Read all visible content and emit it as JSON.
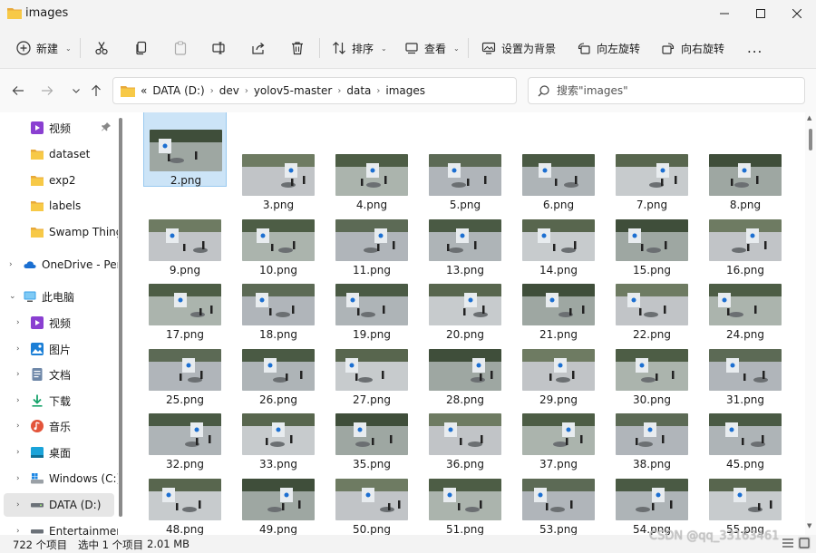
{
  "window": {
    "title": "images"
  },
  "toolbar": {
    "new": "新建",
    "sort": "排序",
    "view": "查看",
    "set_background": "设置为背景",
    "rotate_left": "向左旋转",
    "rotate_right": "向右旋转",
    "more": "..."
  },
  "address": {
    "overflow": "«",
    "crumbs": [
      "DATA (D:)",
      "dev",
      "yolov5-master",
      "data",
      "images"
    ]
  },
  "search": {
    "placeholder": "搜索\"images\""
  },
  "sidebar": {
    "items": [
      {
        "label": "视频",
        "icon": "video-icon"
      },
      {
        "label": "dataset",
        "icon": "folder-icon"
      },
      {
        "label": "exp2",
        "icon": "folder-icon"
      },
      {
        "label": "labels",
        "icon": "folder-icon"
      },
      {
        "label": "Swamp Thing",
        "icon": "folder-icon"
      },
      {
        "label": "OneDrive - Pers",
        "icon": "cloud-icon"
      },
      {
        "label": "此电脑",
        "icon": "computer-icon"
      },
      {
        "label": "视频",
        "icon": "video-icon"
      },
      {
        "label": "图片",
        "icon": "pictures-icon"
      },
      {
        "label": "文档",
        "icon": "documents-icon"
      },
      {
        "label": "下载",
        "icon": "download-icon"
      },
      {
        "label": "音乐",
        "icon": "music-icon"
      },
      {
        "label": "桌面",
        "icon": "desktop-icon"
      },
      {
        "label": "Windows (C:)",
        "icon": "drive-icon"
      },
      {
        "label": "DATA (D:)",
        "icon": "drive-icon"
      },
      {
        "label": "Entertainment",
        "icon": "drive-icon"
      }
    ]
  },
  "files": [
    "2.png",
    "3.png",
    "4.png",
    "5.png",
    "6.png",
    "7.png",
    "8.png",
    "9.png",
    "10.png",
    "11.png",
    "13.png",
    "14.png",
    "15.png",
    "16.png",
    "17.png",
    "18.png",
    "19.png",
    "20.png",
    "21.png",
    "22.png",
    "24.png",
    "25.png",
    "26.png",
    "27.png",
    "28.png",
    "29.png",
    "30.png",
    "31.png",
    "32.png",
    "33.png",
    "35.png",
    "36.png",
    "37.png",
    "38.png",
    "45.png",
    "48.png",
    "49.png",
    "50.png",
    "51.png",
    "53.png",
    "54.png",
    "55.png"
  ],
  "status": {
    "count": "722 个项目",
    "selection": "选中 1 个项目",
    "size": "2.01 MB"
  },
  "watermark": "CSDN @qq_33163461",
  "colors": {
    "accent": "#0067c0",
    "selection": "#cce4f7",
    "folder": "#f4c542"
  }
}
